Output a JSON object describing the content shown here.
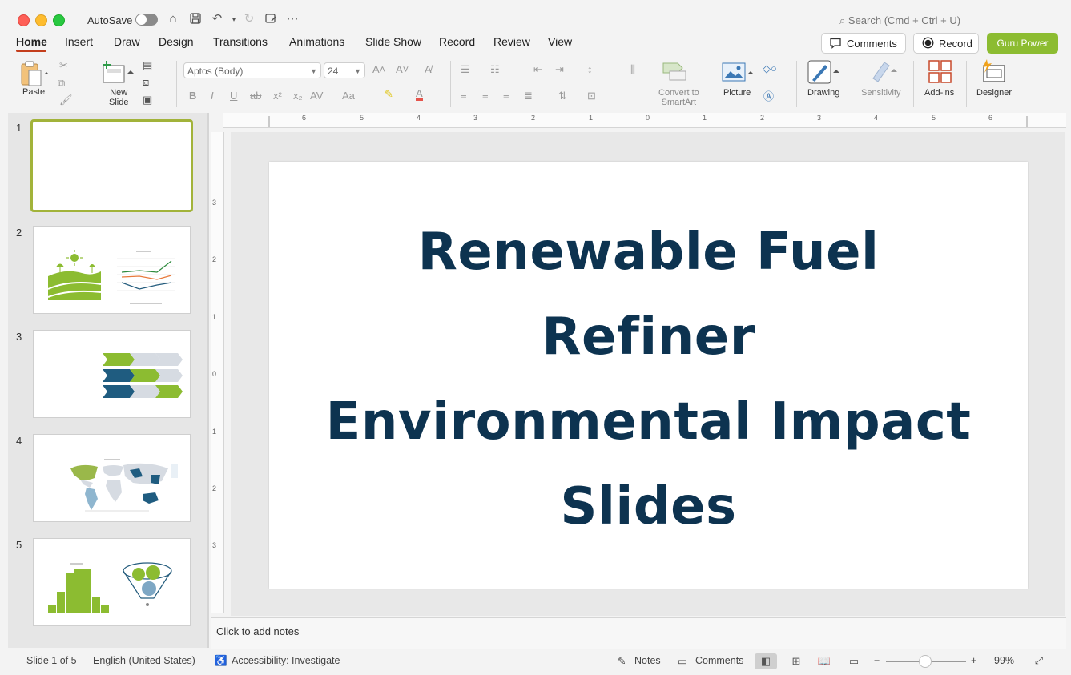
{
  "titlebar": {
    "autosave_label": "AutoSave",
    "search_placeholder": "Search (Cmd + Ctrl + U)"
  },
  "tabs": [
    {
      "label": "Home"
    },
    {
      "label": "Insert"
    },
    {
      "label": "Draw"
    },
    {
      "label": "Design"
    },
    {
      "label": "Transitions"
    },
    {
      "label": "Animations"
    },
    {
      "label": "Slide Show"
    },
    {
      "label": "Record"
    },
    {
      "label": "Review"
    },
    {
      "label": "View"
    }
  ],
  "header_buttons": {
    "comments": "Comments",
    "record": "Record",
    "guru": "Guru Power"
  },
  "ribbon": {
    "paste": "Paste",
    "new_slide_1": "New",
    "new_slide_2": "Slide",
    "font_name": "Aptos (Body)",
    "font_size": "24",
    "convert_1": "Convert to",
    "convert_2": "SmartArt",
    "picture": "Picture",
    "drawing": "Drawing",
    "sensitivity": "Sensitivity",
    "addins": "Add-ins",
    "designer": "Designer"
  },
  "slides": [
    {
      "number": "1"
    },
    {
      "number": "2"
    },
    {
      "number": "3"
    },
    {
      "number": "4"
    },
    {
      "number": "5"
    }
  ],
  "slide": {
    "title_line1": "Renewable Fuel",
    "title_line2": "Refiner",
    "title_line3": "Environmental Impact",
    "title_line4": "Slides"
  },
  "ruler": {
    "top": [
      "6",
      "5",
      "4",
      "3",
      "2",
      "1",
      "0",
      "1",
      "2",
      "3",
      "4",
      "5",
      "6"
    ],
    "left": [
      "3",
      "2",
      "1",
      "0",
      "1",
      "2",
      "3"
    ]
  },
  "notes_placeholder": "Click to add notes",
  "status": {
    "slide_count": "Slide 1 of 5",
    "language": "English (United States)",
    "accessibility": "Accessibility: Investigate",
    "notes": "Notes",
    "comments": "Comments",
    "zoom": "99%"
  },
  "colors": {
    "accent_tab": "#c43e1c",
    "title_color": "#0d3350",
    "guru_button": "#8cbc31",
    "selected_thumb_border": "#a2b33a"
  }
}
